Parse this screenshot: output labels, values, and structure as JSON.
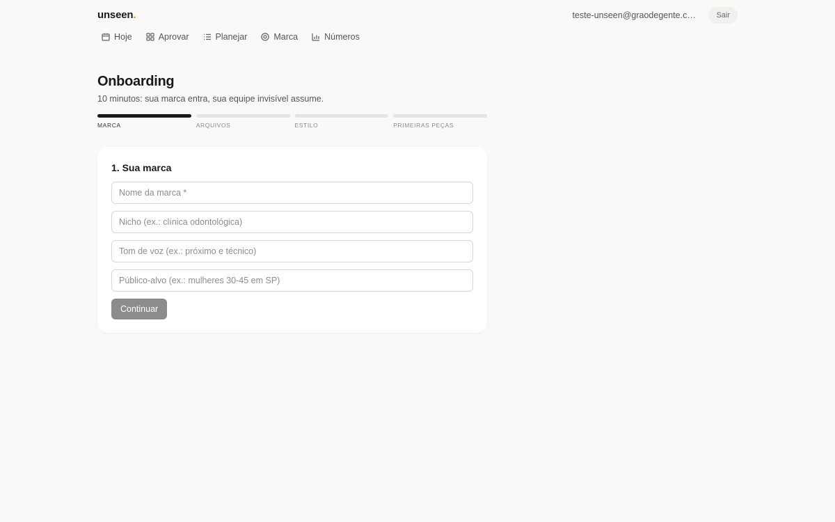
{
  "header": {
    "logo_text": "unseen",
    "logo_dot": ".",
    "email": "teste-unseen@graodegente.co...",
    "logout_label": "Sair"
  },
  "nav": {
    "items": [
      {
        "label": "Hoje",
        "icon": "calendar-icon"
      },
      {
        "label": "Aprovar",
        "icon": "grid-icon"
      },
      {
        "label": "Planejar",
        "icon": "list-icon"
      },
      {
        "label": "Marca",
        "icon": "target-icon"
      },
      {
        "label": "Números",
        "icon": "bar-chart-icon"
      }
    ]
  },
  "page": {
    "title": "Onboarding",
    "subtitle": "10 minutos: sua marca entra, sua equipe invisível assume."
  },
  "steps": {
    "current": 1,
    "items": [
      {
        "label": "Marca"
      },
      {
        "label": "Arquivos"
      },
      {
        "label": "Estilo"
      },
      {
        "label": "Primeiras peças"
      }
    ]
  },
  "form": {
    "title": "1. Sua marca",
    "fields": [
      {
        "value": "",
        "placeholder": "Nome da marca *"
      },
      {
        "value": "",
        "placeholder": "Nicho (ex.: clínica odontológica)"
      },
      {
        "value": "",
        "placeholder": "Tom de voz (ex.: próximo e técnico)"
      },
      {
        "value": "",
        "placeholder": "Público-alvo (ex.: mulheres 30-45 em SP)"
      }
    ],
    "submit_label": "Continuar"
  },
  "colors": {
    "background": "#faf9f7",
    "logo_dot": "#d9822b",
    "step_active": "#1a1a1a",
    "step_inactive": "#e6e5e2",
    "button_disabled": "#8c8c8c"
  }
}
